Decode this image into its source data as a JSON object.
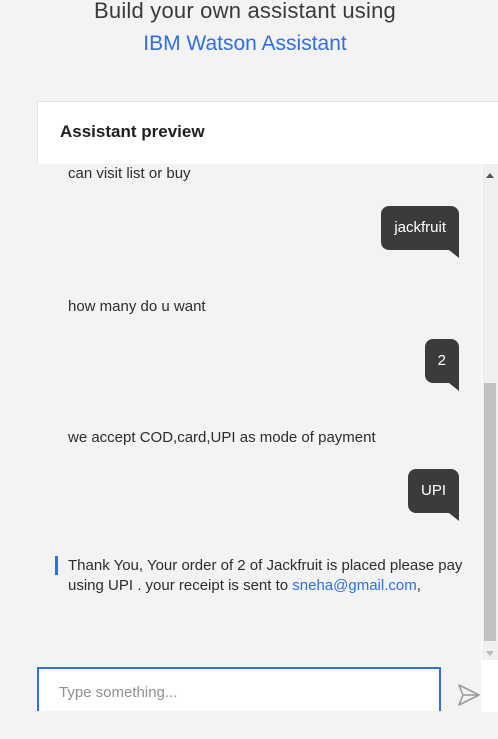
{
  "header": {
    "line1": "Build your own assistant using",
    "line2": "IBM Watson Assistant"
  },
  "panel": {
    "title": "Assistant preview"
  },
  "messages": {
    "bot1": "can visit list or buy",
    "user1": "jackfruit",
    "bot2": "how many do u want",
    "user2": "2",
    "bot3": "we accept COD,card,UPI as mode of payment",
    "user3": "UPI",
    "bot4_text": "Thank You, Your order of 2 of Jackfruit is placed please pay using UPI . your receipt is sent to ",
    "bot4_email": "sneha@gmail.com",
    "bot4_suffix": ","
  },
  "input": {
    "placeholder": "Type something..."
  },
  "colors": {
    "accent": "#2f6fe0",
    "bubble": "#3b3b3b",
    "chat_bg": "#f3f3f3"
  },
  "icons": {
    "send": "send-arrow-icon",
    "scroll_up": "caret-up-icon",
    "scroll_down": "caret-down-icon"
  }
}
